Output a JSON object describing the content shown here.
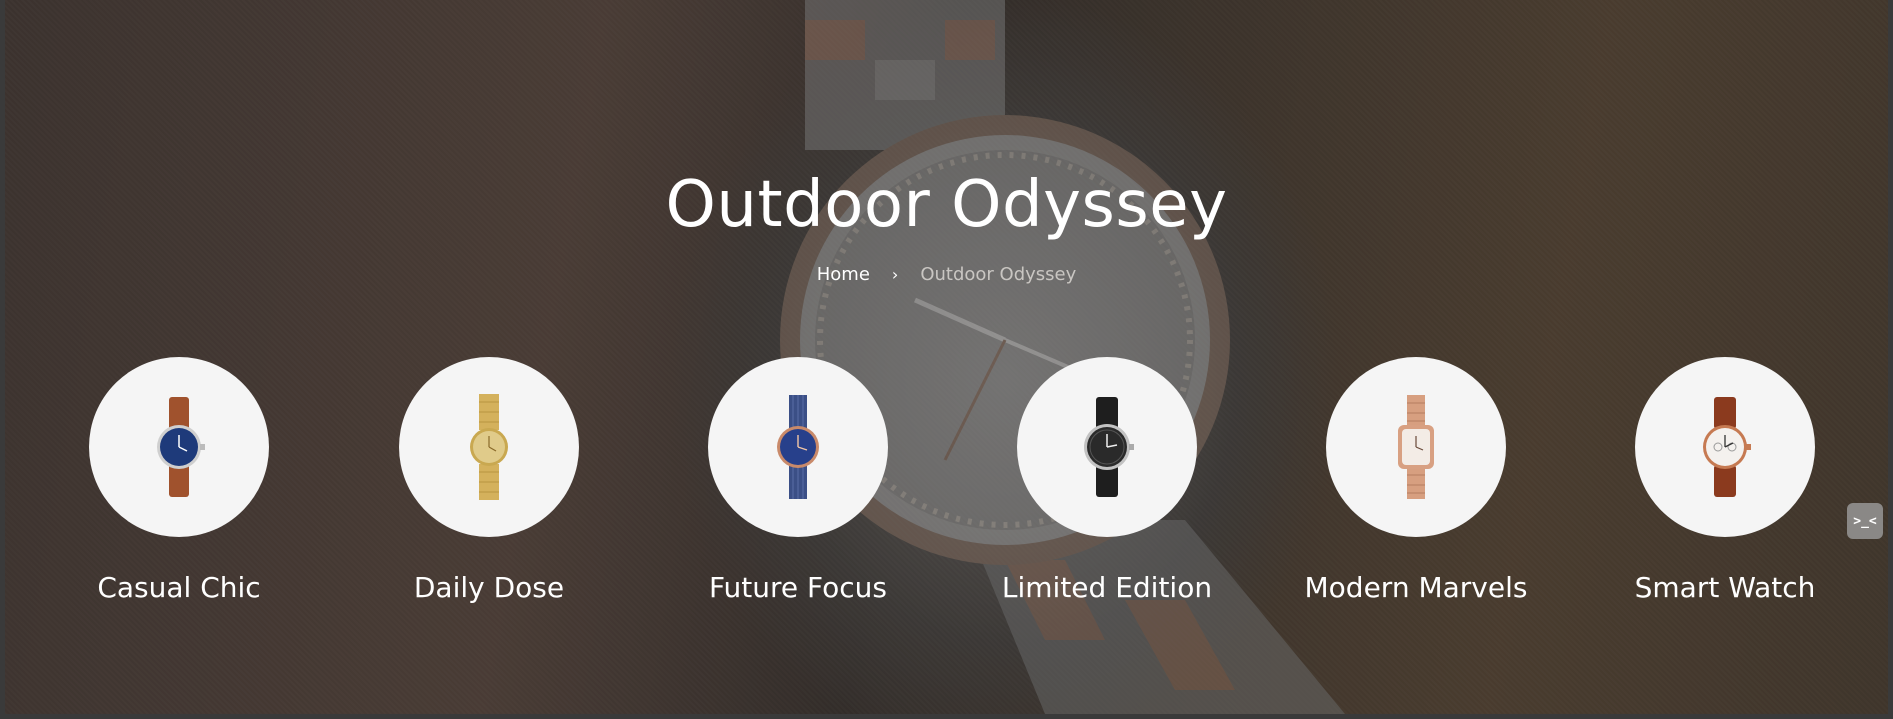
{
  "hero": {
    "title": "Outdoor Odyssey",
    "breadcrumb": {
      "home": "Home",
      "separator": "›",
      "current": "Outdoor Odyssey"
    }
  },
  "categories": [
    {
      "label": "Casual Chic",
      "icon": "brown-leather-blue-dial-watch-icon"
    },
    {
      "label": "Daily Dose",
      "icon": "gold-bracelet-watch-icon"
    },
    {
      "label": "Future Focus",
      "icon": "blue-mesh-watch-icon"
    },
    {
      "label": "Limited Edition",
      "icon": "black-leather-watch-icon"
    },
    {
      "label": "Modern Marvels",
      "icon": "rose-gold-rectangular-watch-icon"
    },
    {
      "label": "Smart Watch",
      "icon": "brown-leather-chronograph-watch-icon"
    }
  ],
  "side_button": {
    "label": ">_<"
  },
  "colors": {
    "text": "#ffffff",
    "circle": "#f5f5f5",
    "breadcrumb_current": "#c9c6c2"
  }
}
